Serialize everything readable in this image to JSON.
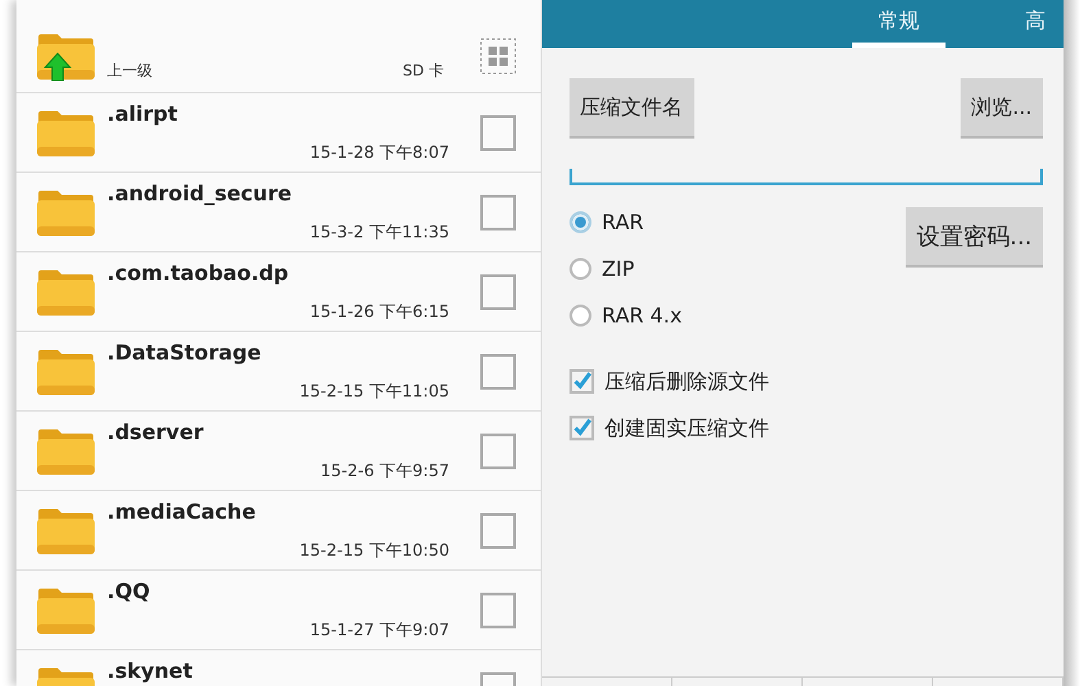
{
  "file_list": {
    "up": {
      "label": "上一级",
      "storage": "SD 卡"
    },
    "items": [
      {
        "name": ".alirpt",
        "date": "15-1-28 下午8:07",
        "checked": false
      },
      {
        "name": ".android_secure",
        "date": "15-3-2 下午11:35",
        "checked": false
      },
      {
        "name": ".com.taobao.dp",
        "date": "15-1-26 下午6:15",
        "checked": false
      },
      {
        "name": ".DataStorage",
        "date": "15-2-15 下午11:05",
        "checked": false
      },
      {
        "name": ".dserver",
        "date": "15-2-6 下午9:57",
        "checked": false
      },
      {
        "name": ".mediaCache",
        "date": "15-2-15 下午10:50",
        "checked": false
      },
      {
        "name": ".QQ",
        "date": "15-1-27 下午9:07",
        "checked": false
      },
      {
        "name": ".skynet",
        "checked": false
      }
    ]
  },
  "tabs": [
    {
      "label": "常规",
      "selected": true
    },
    {
      "label": "高",
      "selected": false
    }
  ],
  "archive_name_button": "压缩文件名",
  "browse_button": "浏览...",
  "password_button": "设置密码...",
  "formats": [
    {
      "label": "RAR",
      "selected": true
    },
    {
      "label": "ZIP",
      "selected": false
    },
    {
      "label": "RAR 4.x",
      "selected": false
    }
  ],
  "options": [
    {
      "label": "压缩后删除源文件",
      "checked": true
    },
    {
      "label": "创建固实压缩文件",
      "checked": true
    }
  ]
}
